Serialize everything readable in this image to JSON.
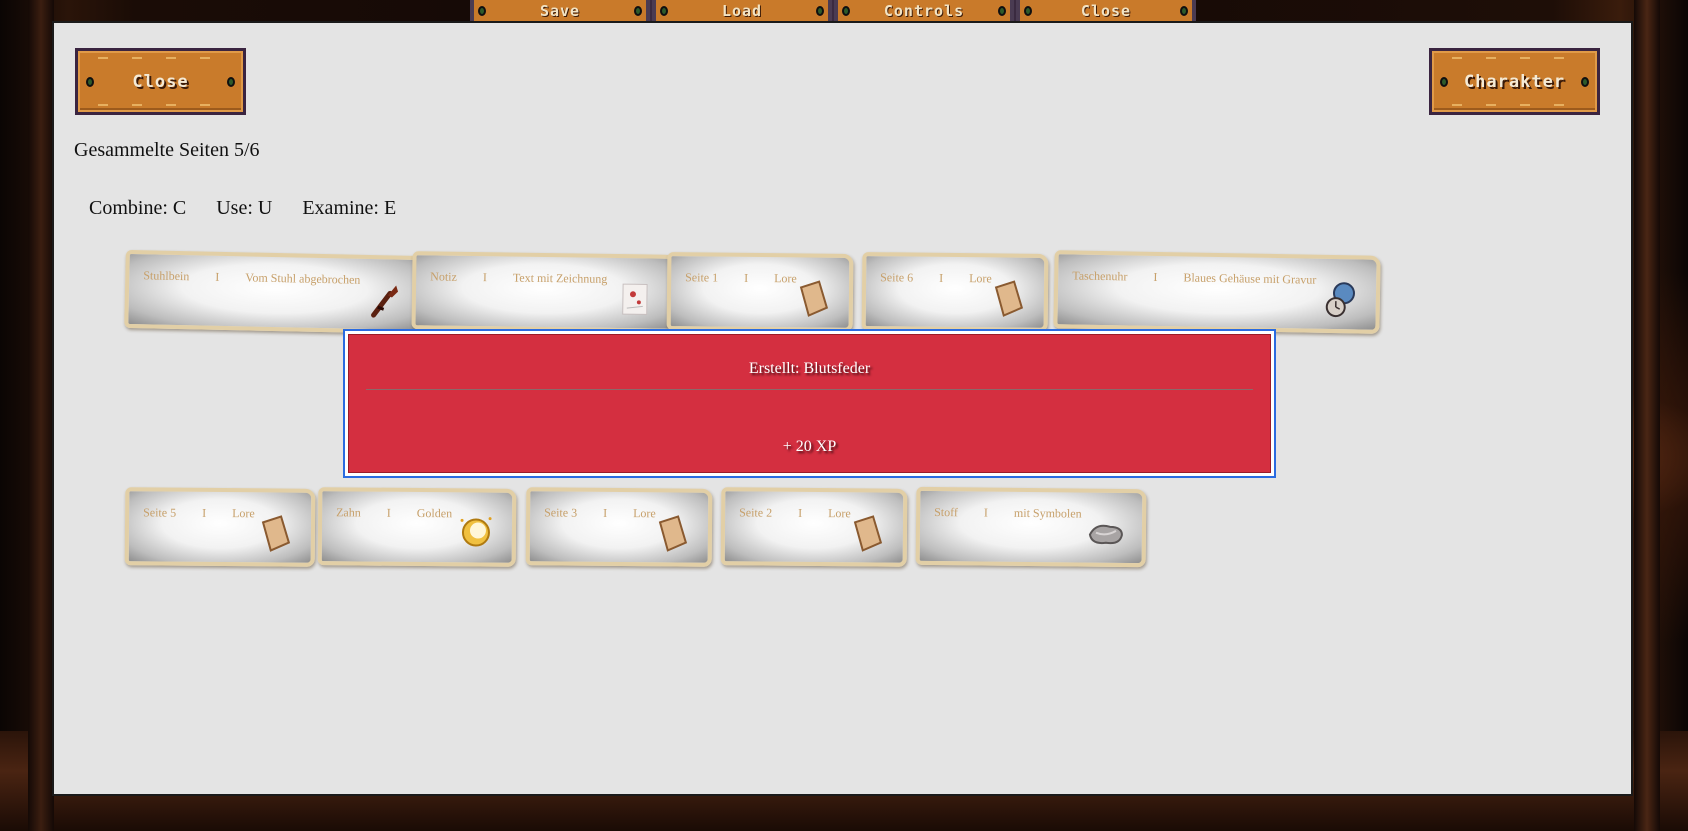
{
  "top_menu": {
    "save": "Save",
    "load": "Load",
    "controls": "Controls",
    "close": "Close"
  },
  "panel": {
    "close_button": "Close",
    "character_button": "Charakter",
    "collected_pages": "Gesammelte Seiten 5/6",
    "hints": [
      "Combine: C",
      "Use: U",
      "Examine: E"
    ]
  },
  "items": [
    {
      "name": "Stuhlbein",
      "sep": "I",
      "desc": "Vom Stuhl abgebrochen",
      "icon": "chair-leg-icon"
    },
    {
      "name": "Notiz",
      "sep": "I",
      "desc": "Text mit Zeichnung",
      "icon": "note-icon"
    },
    {
      "name": "Seite 1",
      "sep": "I",
      "desc": "Lore",
      "icon": "page-icon"
    },
    {
      "name": "Seite 6",
      "sep": "I",
      "desc": "Lore",
      "icon": "page-icon"
    },
    {
      "name": "Taschenuhr",
      "sep": "I",
      "desc": "Blaues Gehäuse mit Gravur",
      "icon": "pocket-watch-icon"
    },
    {
      "name": "Seite 5",
      "sep": "I",
      "desc": "Lore",
      "icon": "page-icon"
    },
    {
      "name": "Zahn",
      "sep": "I",
      "desc": "Golden",
      "icon": "golden-tooth-icon"
    },
    {
      "name": "Seite 3",
      "sep": "I",
      "desc": "Lore",
      "icon": "page-icon"
    },
    {
      "name": "Seite 2",
      "sep": "I",
      "desc": "Lore",
      "icon": "page-icon"
    },
    {
      "name": "Stoff",
      "sep": "I",
      "desc": "mit Symbolen",
      "icon": "cloth-icon"
    }
  ],
  "popup": {
    "title": "Erstellt: Blutsfeder",
    "xp": "+ 20 XP"
  },
  "colors": {
    "panel_bg": "#e4e4e4",
    "button_orange": "#c97b2b",
    "popup_red": "#d42f40",
    "item_text": "#c7a06a"
  }
}
